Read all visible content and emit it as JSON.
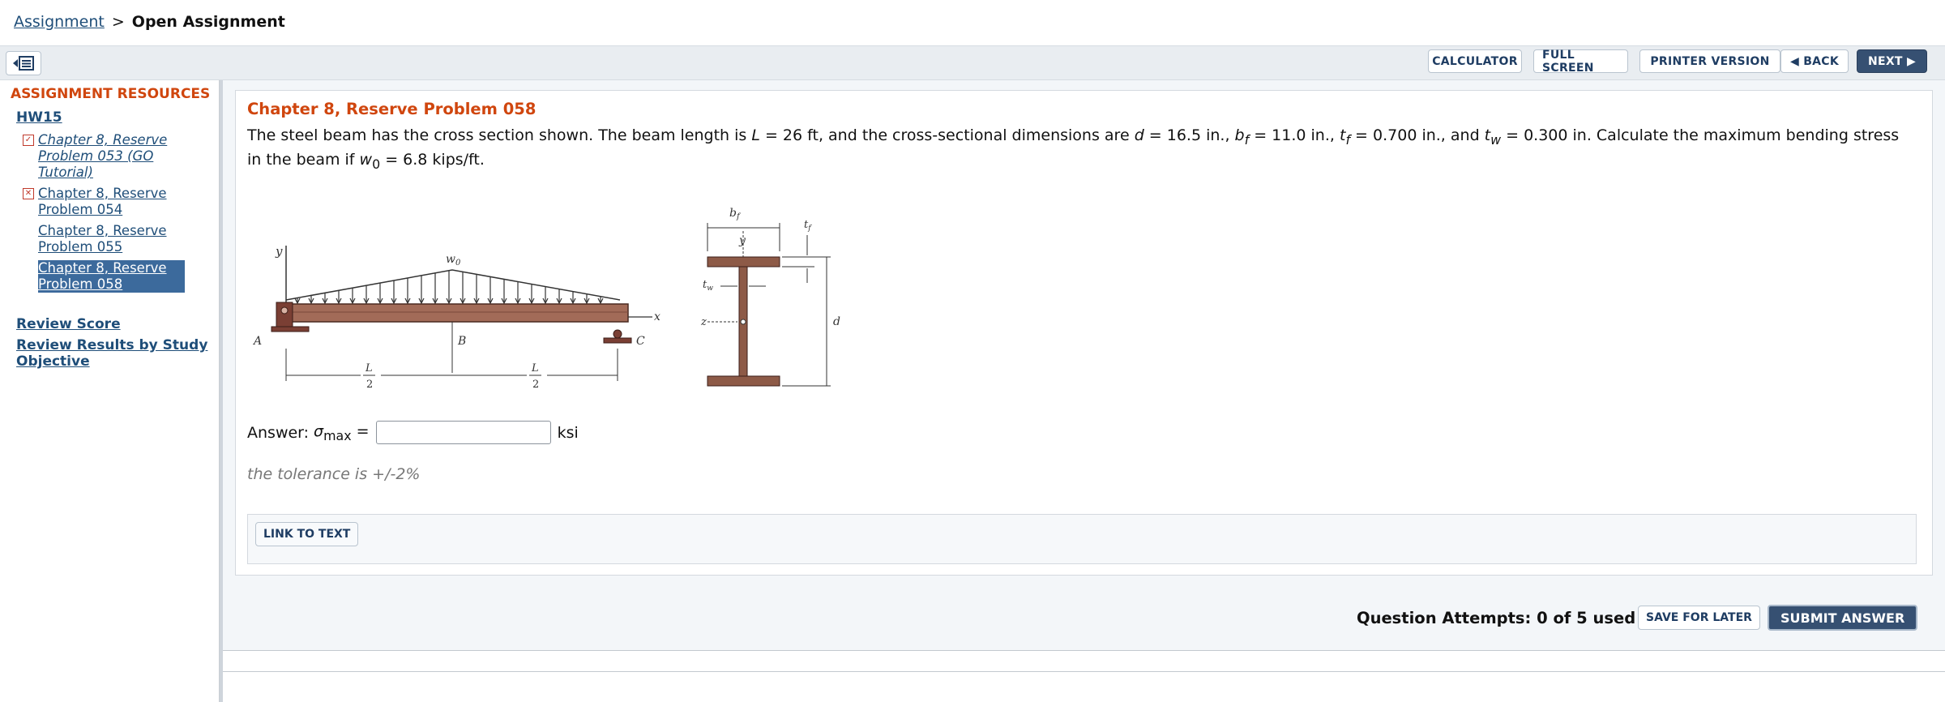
{
  "breadcrumb": {
    "link": "Assignment",
    "separator": ">",
    "current": "Open Assignment"
  },
  "toolbar": {
    "calculator": "CALCULATOR",
    "full_screen": "FULL SCREEN",
    "printer_version": "PRINTER VERSION",
    "back": "◀ BACK",
    "next": "NEXT ▶"
  },
  "sidebar": {
    "title": "ASSIGNMENT RESOURCES",
    "assignment": "HW15",
    "problems": [
      {
        "label": "Chapter 8, Reserve Problem 053 (GO Tutorial)",
        "status": "✓"
      },
      {
        "label": "Chapter 8, Reserve Problem 054",
        "status": "✕"
      },
      {
        "label": "Chapter 8, Reserve Problem 055",
        "status": ""
      },
      {
        "label": "Chapter 8, Reserve Problem 058",
        "status": ""
      }
    ],
    "review_score": "Review Score",
    "review_results": "Review Results by Study Objective"
  },
  "question": {
    "title": "Chapter 8, Reserve Problem 058",
    "text_1": "The steel beam has the cross section shown. The beam length is ",
    "L_sym": "L",
    "text_2": " = 26 ft, and the cross-sectional dimensions are ",
    "d_sym": "d",
    "text_3": " = 16.5 in., ",
    "bf_sym": "b",
    "bf_sub": "f",
    "text_4": " = 11.0 in., ",
    "tf_sym": "t",
    "tf_sub": "f",
    "text_5": " = 0.700 in., and ",
    "tw_sym": "t",
    "tw_sub": "w",
    "text_6": " = 0.300 in. Calculate the maximum bending stress in the beam if ",
    "w_sym": "w",
    "w_sub": "0",
    "text_7": " = 6.8 kips/ft."
  },
  "figure": {
    "y": "y",
    "w0": "w",
    "w0_sub": "0",
    "x": "x",
    "A": "A",
    "B": "B",
    "C": "C",
    "L": "L",
    "two": "2",
    "bf": "b",
    "bf_sub": "f",
    "tf": "t",
    "tf_sub": "f",
    "tw": "t",
    "tw_sub": "w",
    "z": "z",
    "d": "d",
    "y2": "y",
    "colors": {
      "beam": "#a26b58",
      "flange": "#8d5a47",
      "support": "#7a3f34"
    }
  },
  "answer": {
    "label": "Answer: ",
    "sigma": "σ",
    "sub": "max",
    "equals": " =",
    "unit": "ksi",
    "value": "",
    "tolerance": "the tolerance is +/-2%"
  },
  "link_to_text": "LINK TO TEXT",
  "footer": {
    "attempts": "Question Attempts: 0 of 5 used",
    "save": "SAVE FOR LATER",
    "submit": "SUBMIT ANSWER"
  }
}
